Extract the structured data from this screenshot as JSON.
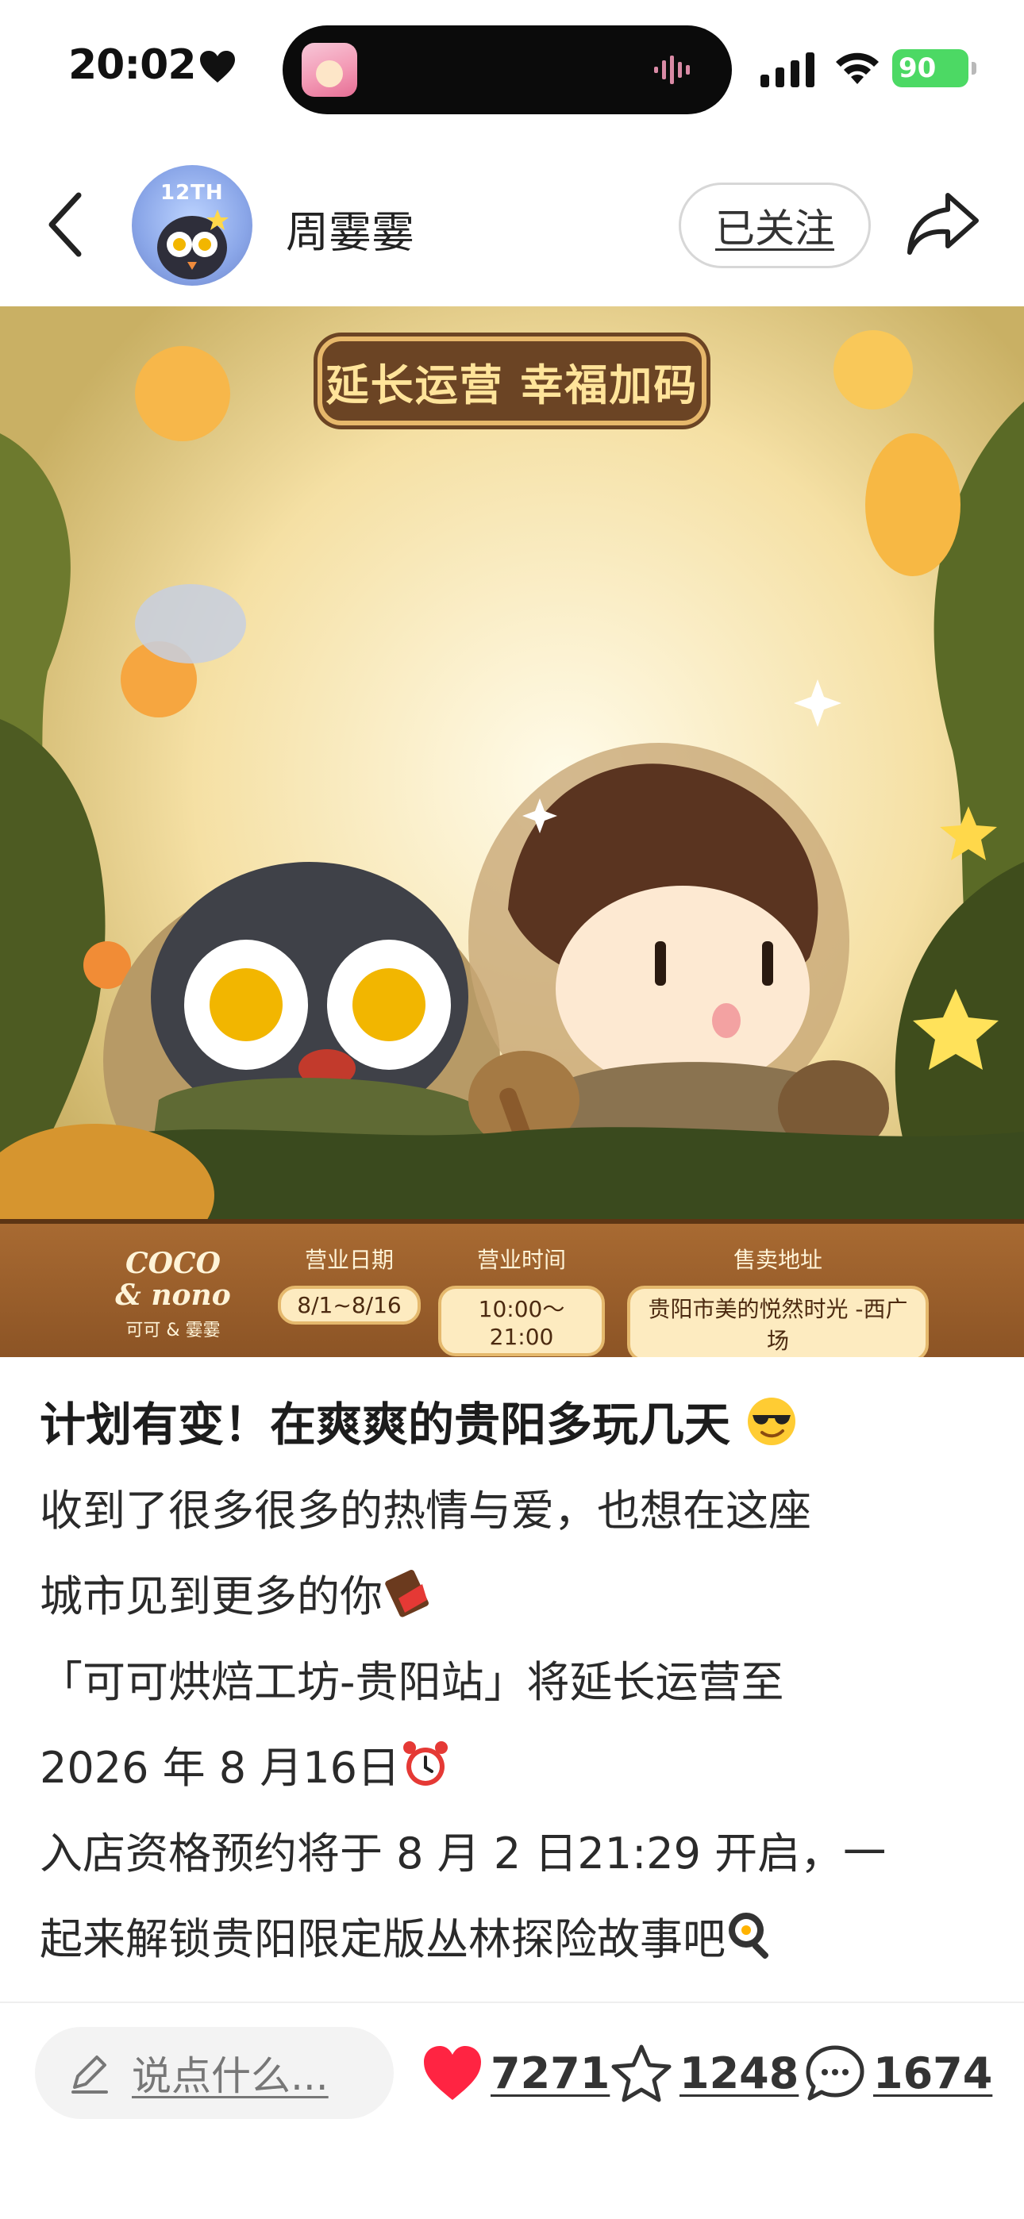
{
  "status_bar": {
    "time": "20:02",
    "battery": "90"
  },
  "header": {
    "author": "周霎霎",
    "avatar_badge": "12TH",
    "follow_label": "已关注"
  },
  "poster": {
    "banner": "延长运营 幸福加码",
    "brand_logo_lines": [
      "COCO",
      "& nono"
    ],
    "brand_sub": "可可 & 霎霎",
    "info": [
      {
        "label": "营业日期",
        "value": "8/1~8/16"
      },
      {
        "label": "营业时间",
        "value": "10:00～21:00"
      },
      {
        "label": "售卖地址",
        "value": "贵阳市美的悦然时光 -西广场"
      }
    ]
  },
  "post": {
    "title": "计划有变！在爽爽的贵阳多玩几天",
    "lines": [
      "收到了很多很多的热情与爱，也想在这座",
      "城市见到更多的你",
      "「可可烘焙工坊-贵阳站」将延长运营至",
      " 2026 年 8 月16日",
      "入店资格预约将于 8 月 2 日21:29 开启，一",
      "起来解锁贵阳限定版丛林探险故事吧"
    ]
  },
  "bottom_bar": {
    "comment_placeholder": "说点什么...",
    "likes": "7271",
    "favorites": "1248",
    "comments": "1674"
  },
  "colors": {
    "like_red": "#ff2442",
    "battery_green": "#4cd964",
    "banner_brown": "#6b4424"
  }
}
